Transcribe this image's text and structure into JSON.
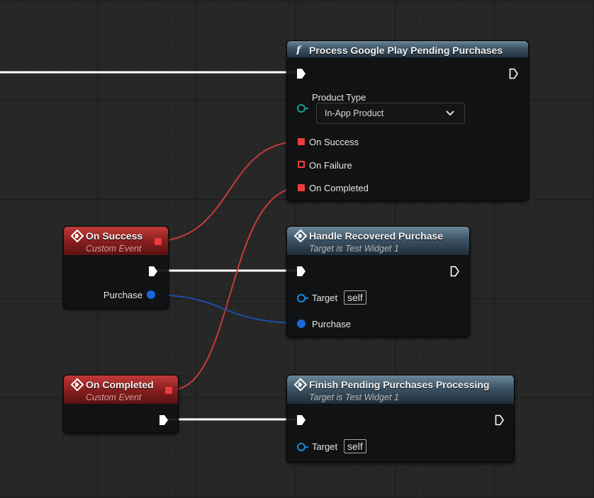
{
  "nodes": {
    "process": {
      "title": "Process Google Play Pending Purchases",
      "input_label": "Product Type",
      "dropdown_value": "In-App Product",
      "outputs": [
        "On Success",
        "On Failure",
        "On Completed"
      ]
    },
    "on_success": {
      "title": "On Success",
      "subtitle": "Custom Event",
      "output_label": "Purchase"
    },
    "handle": {
      "title": "Handle Recovered Purchase",
      "subtitle": "Target is Test Widget 1",
      "target_label": "Target",
      "target_value": "self",
      "purchase_label": "Purchase"
    },
    "on_completed": {
      "title": "On Completed",
      "subtitle": "Custom Event"
    },
    "finish": {
      "title": "Finish Pending Purchases Processing",
      "subtitle": "Target is Test Widget 1",
      "target_label": "Target",
      "target_value": "self"
    }
  },
  "colors": {
    "event_header": "#8a1f1f",
    "function_header": "#3d5465",
    "exec_wire": "#ffffff",
    "delegate_wire": "#c83a3a",
    "struct_wire": "#1a4fa8",
    "delegate_pin": "#ee3b3b",
    "struct_pin": "#1a66d9",
    "enum_pin": "#1a9e8a"
  },
  "icons": {
    "function": "function-icon",
    "event": "event-diamond-icon",
    "exec": "exec-pin-icon"
  }
}
